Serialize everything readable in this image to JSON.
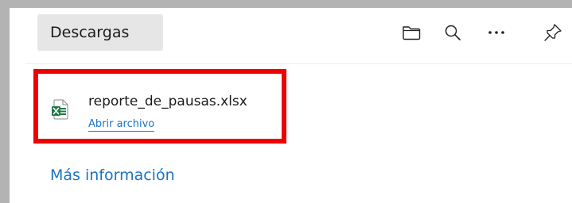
{
  "header": {
    "title": "Descargas"
  },
  "toolbar": {
    "icons": [
      "folder-icon",
      "search-icon",
      "more-icon",
      "pin-icon"
    ]
  },
  "downloads": [
    {
      "file_name": "reporte_de_pausas.xlsx",
      "action_label": "Abrir archivo",
      "icon": "excel-file-icon"
    }
  ],
  "footer": {
    "more_info_label": "Más información"
  },
  "colors": {
    "link": "#1a73c8",
    "highlight_border": "#ee0000",
    "excel_green": "#1f7a45"
  }
}
